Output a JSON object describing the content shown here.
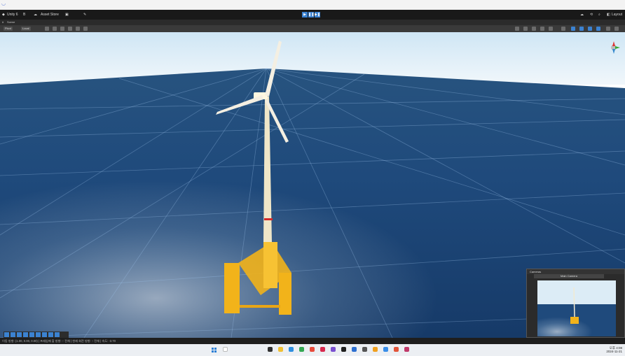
{
  "window": {
    "product": "Unity 6",
    "account_label": "B",
    "asset_store": "Asset Store",
    "layout_label": "Layout",
    "play_controls": [
      "▶",
      "❚❚",
      "▶❚"
    ]
  },
  "scene_tab": {
    "title": "Scene",
    "pivot": "Pivot",
    "local": "Local"
  },
  "camera_panel": {
    "title": "Cameras",
    "selected": "Main Camera"
  },
  "status_bar": {
    "text": "이동 방향: (1.00, 0.00, 0.00) | 프레임에 할 방향: ↑ 전체 | 현재 회전 방향: ↑ 전체 | 속도: -3.70"
  },
  "taskbar": {
    "time": "오후 4:08",
    "date": "2024-11-21"
  },
  "colors": {
    "accent": "#3b82d1",
    "turbine_platform": "#f2b31a",
    "sea": "#1f4e85",
    "sky": "#e6f1f8"
  },
  "icons": [
    "windows-icon",
    "cloud-icon",
    "search-icon",
    "gear-icon",
    "play-icon",
    "pause-icon",
    "step-icon"
  ]
}
